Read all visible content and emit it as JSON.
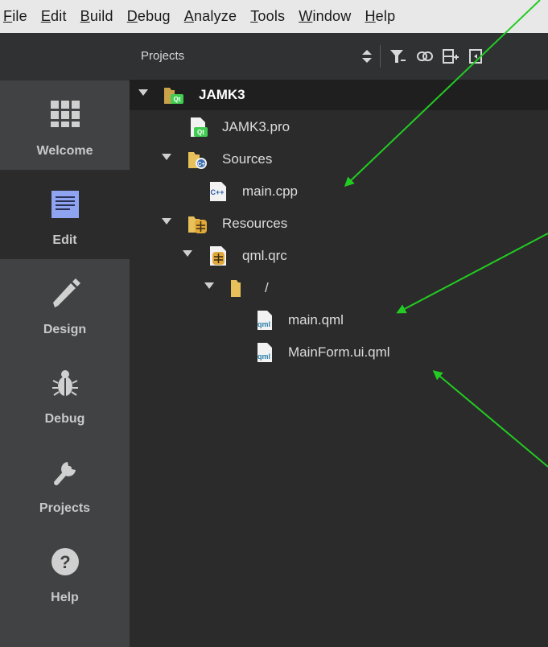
{
  "menubar": {
    "items": [
      {
        "mn": "F",
        "rest": "ile"
      },
      {
        "mn": "E",
        "rest": "dit"
      },
      {
        "mn": "B",
        "rest": "uild"
      },
      {
        "mn": "D",
        "rest": "ebug"
      },
      {
        "mn": "A",
        "rest": "nalyze"
      },
      {
        "mn": "T",
        "rest": "ools"
      },
      {
        "mn": "W",
        "rest": "indow"
      },
      {
        "mn": "H",
        "rest": "elp"
      }
    ]
  },
  "modes": {
    "welcome": "Welcome",
    "edit": "Edit",
    "design": "Design",
    "debug": "Debug",
    "projects": "Projects",
    "help": "Help",
    "active": "edit"
  },
  "toolbar": {
    "title": "Projects",
    "icons": [
      "sort-updown-icon",
      "filter-icon",
      "link-icon",
      "split-add-icon",
      "close-pane-icon"
    ]
  },
  "tree": {
    "root": "JAMK3",
    "pro_file": "JAMK3.pro",
    "sources": "Sources",
    "main_cpp": "main.cpp",
    "resources": "Resources",
    "qml_qrc": "qml.qrc",
    "slash": "/",
    "main_qml": "main.qml",
    "mainform_qml": "MainForm.ui.qml"
  },
  "colors": {
    "accent_arrow": "#22cc22",
    "menubar_bg": "#e8e8e8",
    "tree_bg": "#2b2b2b",
    "modebar_bg": "#404244",
    "folder": "#e8c15a",
    "qt_green": "#41cd52"
  }
}
